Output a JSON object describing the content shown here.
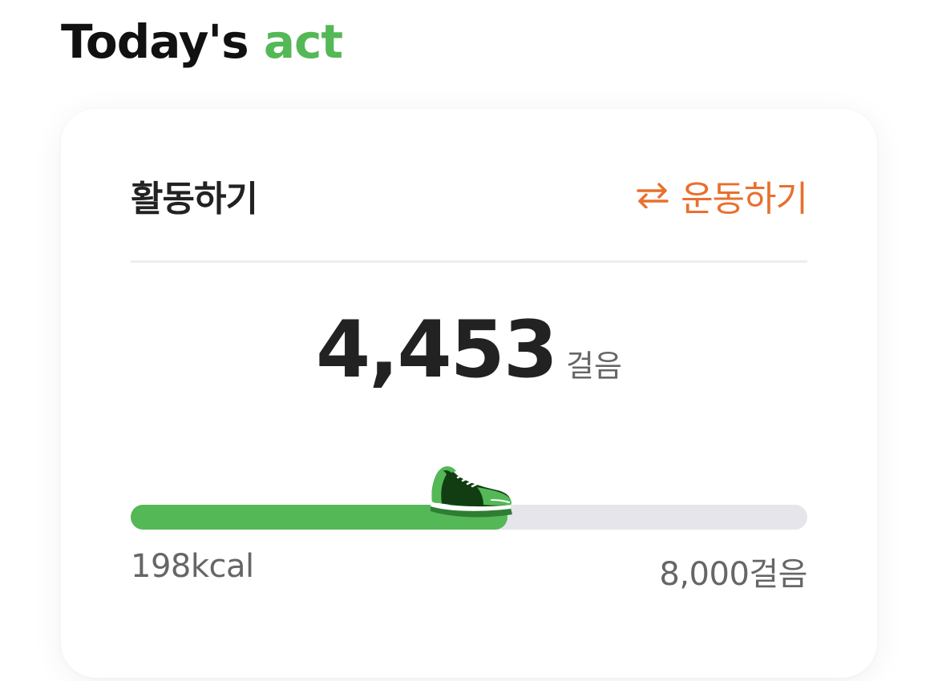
{
  "header": {
    "title_main": "Today's",
    "title_accent": "act"
  },
  "card": {
    "title": "활동하기",
    "switch_label": "운동하기",
    "switch_icon": "swap-arrows-icon",
    "steps": {
      "value": "4,453",
      "unit": "걸음"
    },
    "progress": {
      "fraction": 0.5566,
      "icon": "sneaker-icon",
      "calories_label": "198kcal",
      "goal_label": "8,000걸음"
    }
  },
  "colors": {
    "accent": "#54b856",
    "switch": "#e8702e",
    "text": "#222222",
    "muted": "#666666",
    "track": "#e6e5eb"
  }
}
